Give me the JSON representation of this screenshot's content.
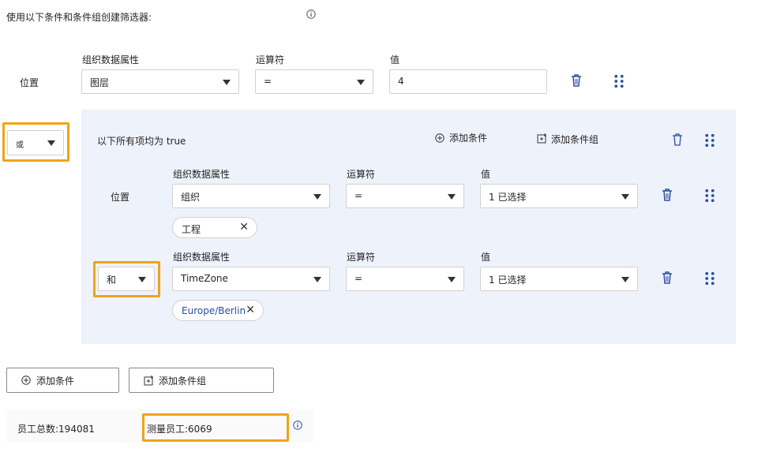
{
  "header": {
    "title": "使用以下条件和条件组创建筛选器:"
  },
  "labels": {
    "attr": "组织数据属性",
    "op": "运算符",
    "val": "值",
    "position": "位置"
  },
  "row1": {
    "attr": "图层",
    "op": "=",
    "value": "4"
  },
  "outer_combinator": "或",
  "group": {
    "title": "以下所有项均为 true",
    "add_condition": "添加条件",
    "add_group": "添加条件组",
    "row1": {
      "attr": "组织",
      "op": "=",
      "value": "1 已选择",
      "chip": "工程"
    },
    "row2": {
      "combinator": "和",
      "attr": "TimeZone",
      "op": "=",
      "value": "1 已选择",
      "chip": "Europe/Berlin"
    }
  },
  "bottom": {
    "add_condition": "添加条件",
    "add_group": "添加条件组"
  },
  "summary": {
    "total": "员工总数:194081",
    "measured": "测量员工:6069"
  },
  "colors": {
    "highlight": "#f0a418",
    "group_bg": "#eef2fb",
    "chip_link": "#2b4ea2"
  }
}
